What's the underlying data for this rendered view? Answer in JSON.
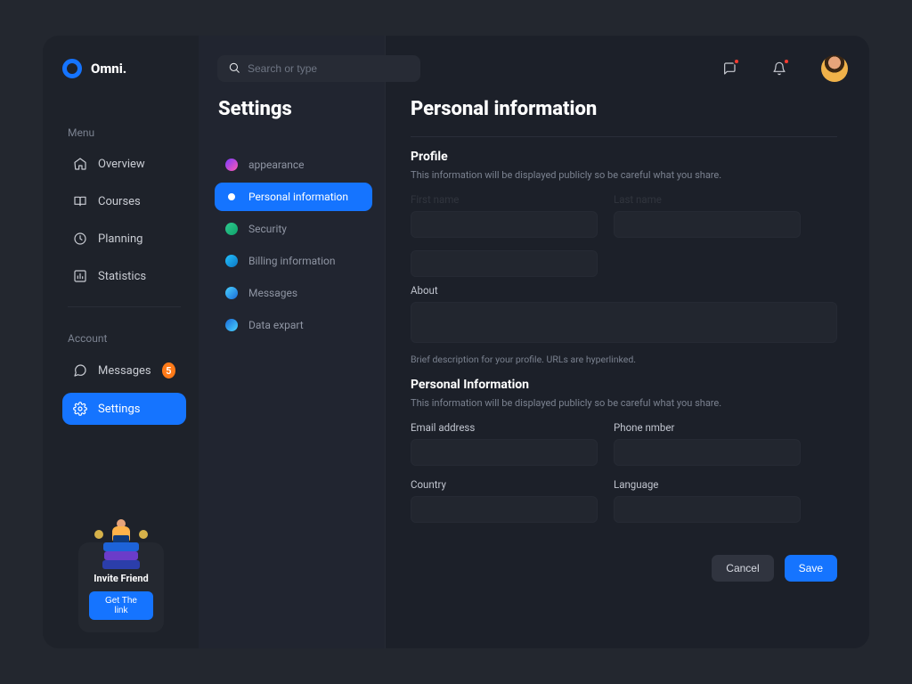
{
  "brand": {
    "name": "Omni."
  },
  "search": {
    "placeholder": "Search or type"
  },
  "sidebar": {
    "menu_label": "Menu",
    "account_label": "Account",
    "items": {
      "overview": "Overview",
      "courses": "Courses",
      "planning": "Planning",
      "statistics": "Statistics",
      "messages": "Messages",
      "settings": "Settings"
    },
    "messages_badge": "5"
  },
  "invite": {
    "title": "Invite Friend",
    "button": "Get The link"
  },
  "settings": {
    "title": "Settings",
    "nav": {
      "appearance": "appearance",
      "personal": "Personal information",
      "security": "Security",
      "billing": "Billing information",
      "messages": "Messages",
      "export": "Data expart"
    }
  },
  "main": {
    "heading": "Personal information",
    "profile": {
      "title": "Profile",
      "subtitle": "This information will be displayed publicly so be careful what you share.",
      "first_name_label": "First name",
      "last_name_label": "Last name",
      "about_label": "About",
      "about_hint": "Brief description for your profile. URLs are hyperlinked."
    },
    "personal": {
      "title": "Personal Information",
      "subtitle": "This information will be displayed publicly so be careful what you share.",
      "email_label": "Email address",
      "phone_label": "Phone nmber",
      "country_label": "Country",
      "language_label": "Language"
    },
    "actions": {
      "cancel": "Cancel",
      "save": "Save"
    }
  },
  "colors": {
    "accent": "#1574ff",
    "badge": "#ff7a18",
    "notif": "#ff3b30",
    "settings_dots": {
      "appearance": "linear-gradient(135deg,#7a3bff,#ff5ab0)",
      "security": "linear-gradient(135deg,#2fc98f,#0fa36b)",
      "billing": "linear-gradient(135deg,#23c2ff,#0c76c2)",
      "messages": "linear-gradient(135deg,#4ad3ff,#1a6bd8)",
      "export": "linear-gradient(135deg,#1a6bd8,#4ad3ff)"
    }
  }
}
